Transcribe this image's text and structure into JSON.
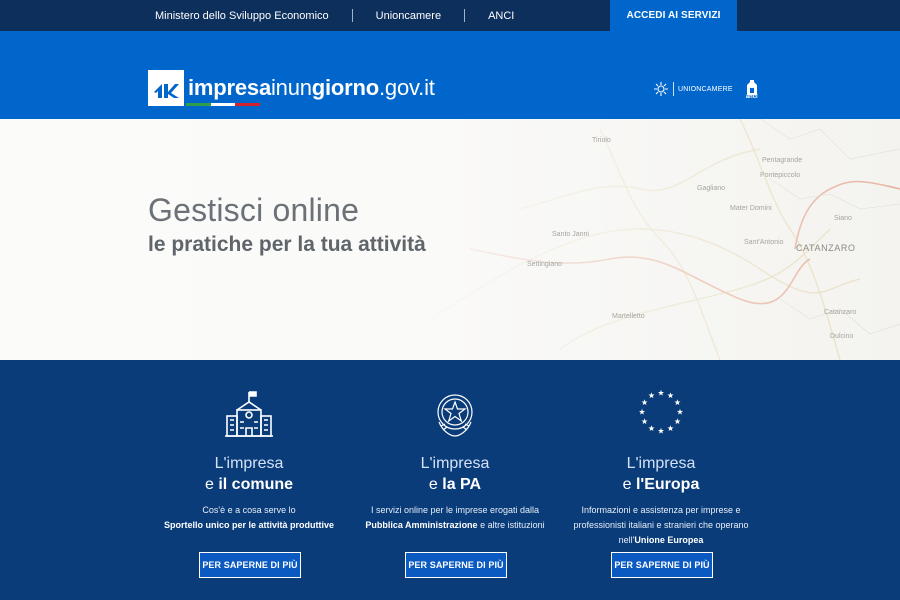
{
  "topbar": {
    "links": [
      "Ministero dello Sviluppo Economico",
      "Unioncamere",
      "ANCI"
    ],
    "accedi": "ACCEDI AI SERVIZI"
  },
  "header": {
    "logo_bold1": "impresa",
    "logo_mid": "inun",
    "logo_bold2": "giorno",
    "logo_tail": ".gov.it",
    "partner1": "UNIONCAMERE",
    "partner2": "anci"
  },
  "hero": {
    "title": "Gestisci online",
    "subtitle": "le pratiche per la tua attività",
    "map_labels": [
      "Tiriolo",
      "Pentagrande",
      "Pontepiccolo",
      "Gagliano",
      "Siano",
      "Mater Domini",
      "Santo Janni",
      "Sant'Antonio",
      "CATANZARO",
      "Catanzaro",
      "Dulcino",
      "Martelletto",
      "Settingiano"
    ]
  },
  "cards": [
    {
      "line1": "L'impresa",
      "line2_pre": "e ",
      "line2_bold": "il comune",
      "desc_1": "Cos'è e a cosa serve lo",
      "desc_bold": "Sportello unico per le attività produttive",
      "desc_2": "",
      "button": "PER SAPERNE DI PIÙ",
      "icon": "town-hall-icon"
    },
    {
      "line1": "L'impresa",
      "line2_pre": "e ",
      "line2_bold": "la PA",
      "desc_1": "I servizi online per le imprese erogati dalla",
      "desc_bold": "Pubblica Amministrazione",
      "desc_2": " e altre istituzioni",
      "button": "PER SAPERNE DI PIÙ",
      "icon": "italian-emblem-icon"
    },
    {
      "line1": "L'impresa",
      "line2_pre": "e ",
      "line2_bold": "l'Europa",
      "desc_1": "Informazioni e assistenza per imprese e professionisti italiani e stranieri che operano nell'",
      "desc_bold": "Unione Europea",
      "desc_2": "",
      "button": "PER SAPERNE DI PIÙ",
      "icon": "eu-stars-icon"
    }
  ],
  "colors": {
    "topbar": "#0d2f5c",
    "header": "#0066cc",
    "bottom": "#0b3c7a",
    "accent_green": "#2e9e4a",
    "accent_red": "#d2222d"
  }
}
